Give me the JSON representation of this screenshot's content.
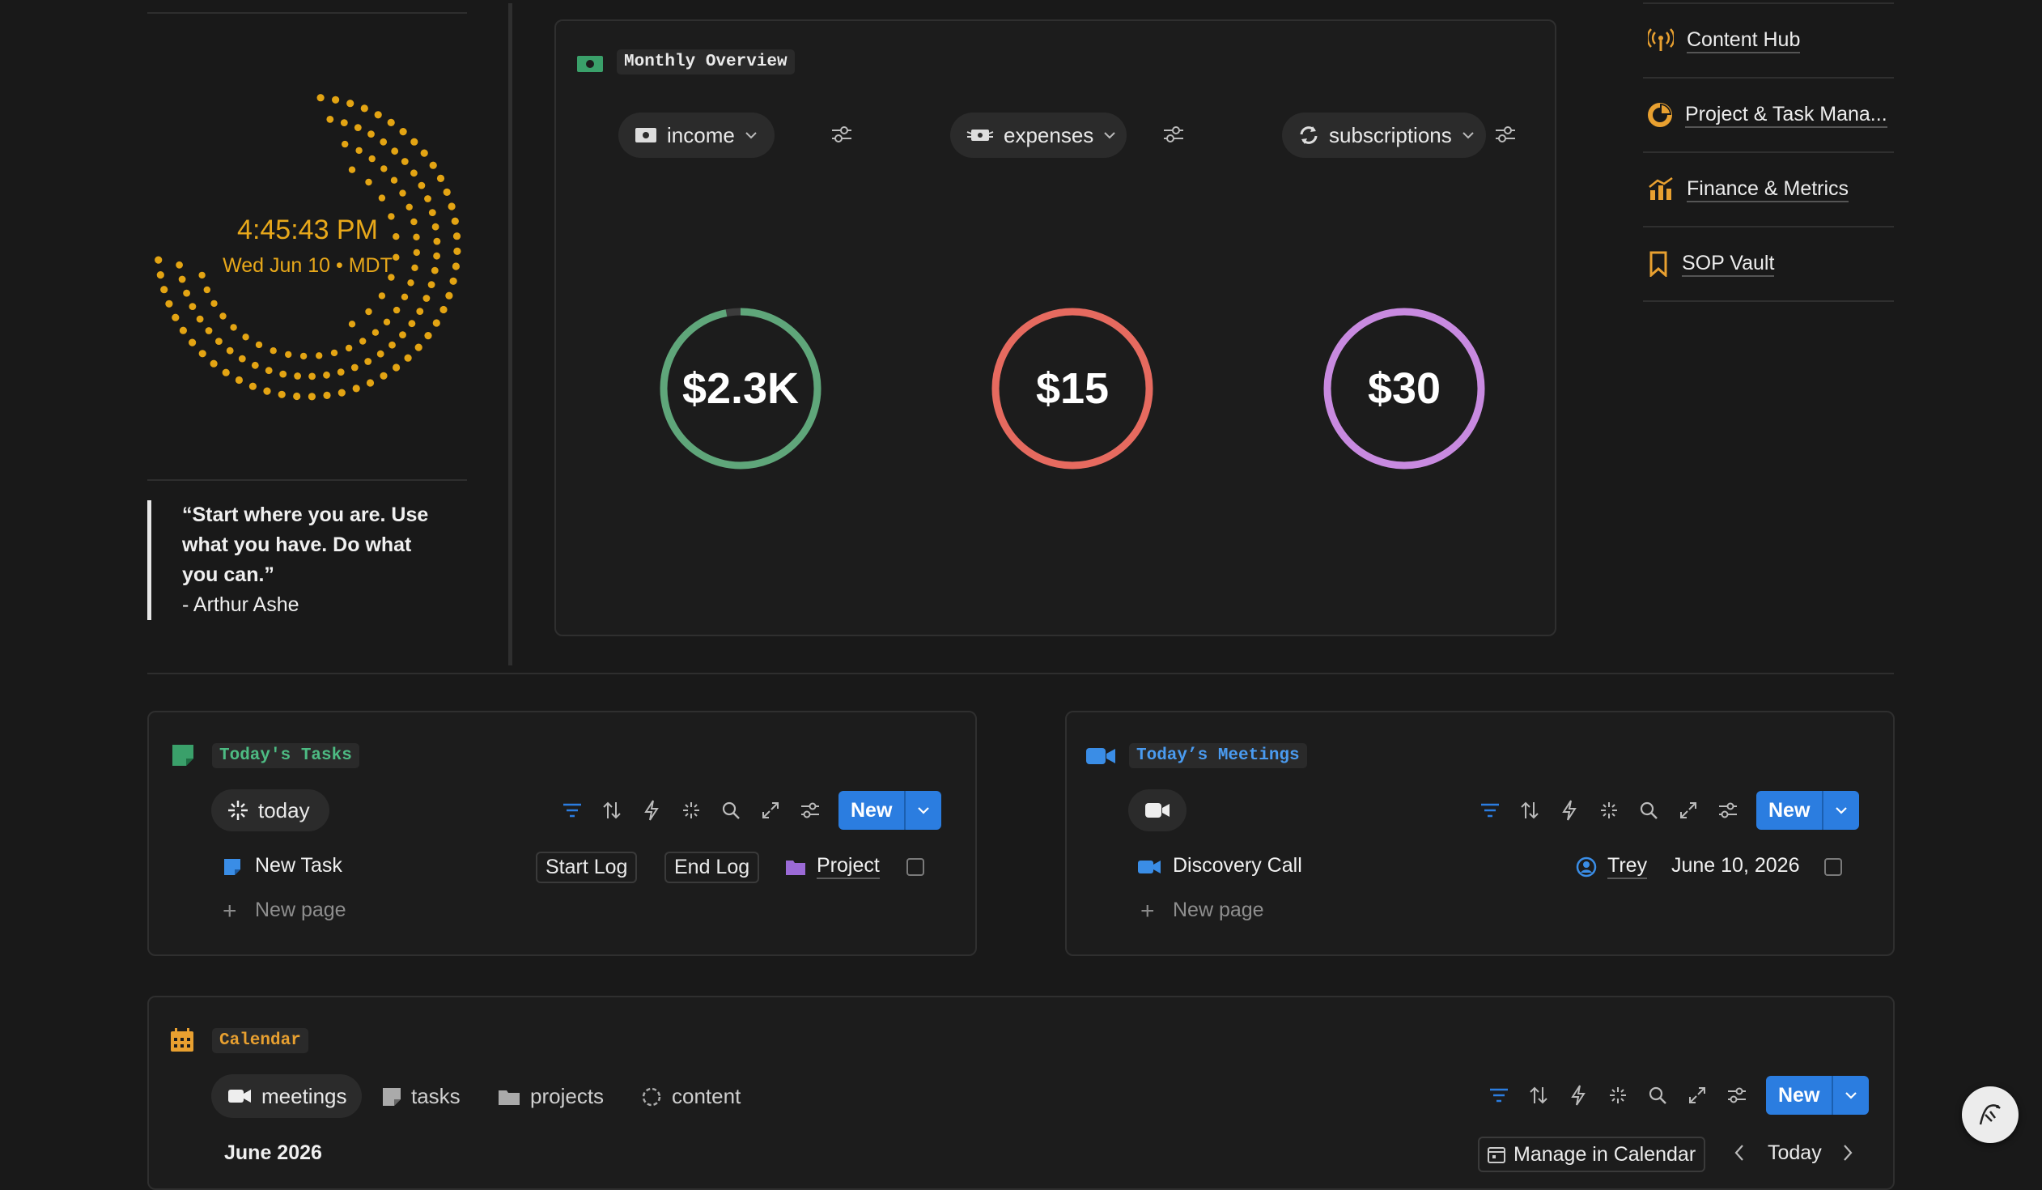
{
  "clock": {
    "time": "4:45:43 PM",
    "date": "Wed Jun 10 • MDT"
  },
  "quote": {
    "text": "“Start where you are. Use what you have. Do what you can.”",
    "author": "- Arthur Ashe"
  },
  "monthly": {
    "title": "Monthly Overview",
    "filters": [
      {
        "label": "income",
        "icon": "cash-icon"
      },
      {
        "label": "expenses",
        "icon": "money-wings-icon"
      },
      {
        "label": "subscriptions",
        "icon": "refresh-icon"
      }
    ],
    "metrics": [
      {
        "value": "$2.3K",
        "color": "#5fa67a",
        "fill": 0.97
      },
      {
        "value": "$15",
        "color": "#e66a5f",
        "fill": 1
      },
      {
        "value": "$30",
        "color": "#c88ae0",
        "fill": 1
      }
    ]
  },
  "nav": [
    {
      "label": "Content Hub",
      "icon": "broadcast-icon"
    },
    {
      "label": "Project & Task Mana...",
      "icon": "pie-chart-icon"
    },
    {
      "label": "Finance & Metrics",
      "icon": "bar-chart-icon"
    },
    {
      "label": "SOP Vault",
      "icon": "bookmark-icon"
    }
  ],
  "tasks": {
    "title": "Today's Tasks",
    "view": "today",
    "new_label": "New",
    "row": {
      "name": "New Task",
      "start": "Start Log",
      "end": "End Log",
      "project": "Project"
    },
    "new_page": "New page"
  },
  "meetings": {
    "title": "Today’s Meetings",
    "new_label": "New",
    "row": {
      "name": "Discovery Call",
      "person": "Trey",
      "date": "June 10, 2026"
    },
    "new_page": "New page"
  },
  "calendar": {
    "title": "Calendar",
    "tabs": [
      "meetings",
      "tasks",
      "projects",
      "content"
    ],
    "new_label": "New",
    "month": "June 2026",
    "manage": "Manage in Calendar",
    "today": "Today"
  },
  "colors": {
    "accent": "#2b7de0",
    "clock": "#e8a81a",
    "green": "#3aa06a",
    "orange": "#e8a030"
  }
}
